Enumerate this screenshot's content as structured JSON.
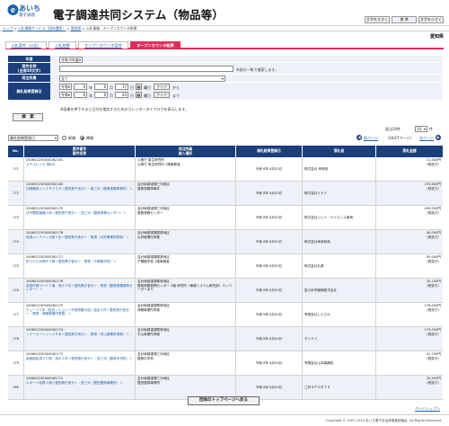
{
  "header": {
    "logo_text": "あいち",
    "logo_sub": "電子調達",
    "title": "電子調達共同システム（物品等）",
    "font_buttons": [
      "文字を大きく",
      "標 準",
      "文字を小さく"
    ]
  },
  "breadcrumb": {
    "items": [
      "トップ",
      "入札情報サービス（団体選択）",
      "愛知県",
      "入札情報：オープンカウンタ結果"
    ],
    "seps": [
      " > ",
      " > ",
      " > "
    ]
  },
  "prefecture": "愛知県",
  "tabs": [
    "入札案件（公告）",
    "入札結果",
    "オープンカウンタ案件",
    "オープンカウンタ結果"
  ],
  "form": {
    "nendo_label": "年度",
    "nendo_value": "令和 6年度",
    "case_label": "案件名称\n(全角50文字)",
    "case_value": "",
    "case_hint": "※部分一致で検索します。",
    "org_label": "発注所属",
    "org_value": "全て",
    "date_label": "開札結果登録日",
    "era": "令和",
    "from": {
      "year": "6",
      "month": "6",
      "day": "17"
    },
    "to": {
      "year": "6",
      "month": "6",
      "day": "20"
    },
    "unit_year": "年",
    "unit_month": "月",
    "unit_day": "日",
    "weekday_from": "曜日",
    "weekday_to": "曜日",
    "clear_label": "クリア",
    "from_word": "から",
    "to_word": "まで",
    "cal_hint": "※画像を押下すると日付を指定するためのカレンダーダイアログを表示します。"
  },
  "search_button": "検　索",
  "sort": {
    "field": "開札結果登録日",
    "asc": "昇順",
    "desc": "降順",
    "count": "該当10件",
    "per_page": "10",
    "per_page_unit": "件",
    "prev": "前ページ",
    "page": "（10/27ページ）",
    "next": "次ページ"
  },
  "columns": [
    "No.",
    "案件番号\n案件名称",
    "発注所属\n納入場所",
    "開札結果登録日",
    "落札者",
    "落札金額"
  ],
  "rows": [
    {
      "no": "171",
      "id": "240602230000062181",
      "name": "メチルレッド 他8点",
      "org": "公衆庁 衛生研究所",
      "place": "公衆庁 衛生研究所 1階事務室",
      "date": "令和 6年 6月20日",
      "company": "株式会社 岸和田",
      "amount": "11,400円",
      "tax": "（税抜き）"
    },
    {
      "no": "172",
      "id": "240602230000062180",
      "name": "印刷機用インクＲ５０Ａ＜愛知県庁舎分＞・東三河〈盟典書籍庫事件〉＞",
      "org": "会計局調達課三河地区",
      "place": "盟典書籍庫事件",
      "date": "令和 6年 6月20日",
      "company": "株式会社ミナミ",
      "amount": "155,800円",
      "tax": "（税抜き）"
    },
    {
      "no": "173",
      "id": "240602230000062179",
      "name": "法令閲覧機器１枚＜愛知県庁舎分＞・西三河（盟典書籍センター）＞",
      "org": "会計局調達課三河地区",
      "place": "盟典書籍センター",
      "date": "令和 6年 6月20日",
      "company": "株式会社ジェイ・サイエンス東海",
      "amount": "430,000円",
      "tax": "（税抜き）"
    },
    {
      "no": "174",
      "id": "240602230000062178",
      "name": "床用メンテナンス剤１缶＜愛知県庁舎分＞・尾張（大府事業所準拠）＞",
      "org": "会計局調達課尾張地区",
      "place": "大府事業所準拠",
      "date": "令和 6年 6月20日",
      "company": "株式会社海老和商",
      "amount": "44,000円",
      "tax": "（税抜き）"
    },
    {
      "no": "175",
      "id": "240602230000062177",
      "name": "折りたたみ椅子５脚＜愛知県庁舎分＞・尾張（子模擬学校）＞",
      "org": "会計局調達課尾張地区",
      "place": "子模擬学校 1階事務室",
      "date": "令和 6年 6月20日",
      "company": "株式会社丸美",
      "amount": "95,000円",
      "tax": "（税抜き）"
    },
    {
      "no": "176",
      "id": "240602230000062176",
      "name": "延長申請コード１個　他の２件＜愛知県庁舎分＞・尾張（盟典書籍振興センター）＞",
      "org": "会計局調達課尾張地区",
      "place": "盟典書籍振興センター 2階 研究所（事務システム研究部）エレベーターあり",
      "date": "令和 6年 6月20日",
      "company": "富士科学器械株式会社",
      "amount": "20,100円",
      "tax": "（税抜き）"
    },
    {
      "no": "177",
      "id": "240602230000062175",
      "name": "チューブ２本（佐伯シミュレータ実際展示品）抽出５件＜愛知県庁舎分＞・尾張（海陽事業所準拠）＞",
      "org": "会計局調達課尾張地区",
      "place": "海陽事業所準拠",
      "date": "令和 6年 6月20日",
      "company": "有限会社しらさわ",
      "amount": "176,000円",
      "tax": "（税抜き）"
    },
    {
      "no": "178",
      "id": "240602230000062174",
      "name": "トナーカートリッジ５本＜愛知県庁舎分＞・尾張（中山事業所準拠）＞",
      "org": "会計局調達課尾張地区",
      "place": "中山事業所準拠",
      "date": "令和 6年 6月20日",
      "company": "モリミツ",
      "amount": "175,000円",
      "tax": "（税抜き）"
    },
    {
      "no": "179",
      "id": "240602230000062173",
      "name": "画面固定用２０個　他の２件＜愛知県庁舎分＞・西三河（盟典中学校）＞",
      "org": "会計局調達課三河地区",
      "place": "盟典中学校",
      "date": "令和 6年 6月20日",
      "company": "有限会社山本森補佐",
      "amount": "41,700円",
      "tax": "（税抜き）"
    },
    {
      "no": "180",
      "id": "240602230000062172",
      "name": "エボーツ用具１個＜愛知県庁舎分＞・西三河（盟田盟典事業所）＞",
      "org": "会計局調達課三河地区",
      "place": "盟田盟典事業所",
      "date": "令和 6年 6月20日",
      "company": "三好ＳＰＯＲＴＳ",
      "amount": "20,900円",
      "tax": "（税抜き）"
    }
  ],
  "bottom_button": "団体のトップページへ戻る",
  "pagetop": "ページトップへ",
  "copyright": "Copyright © 2007-2024 あいち電子自治体推進協議会. All Rights Reserved."
}
